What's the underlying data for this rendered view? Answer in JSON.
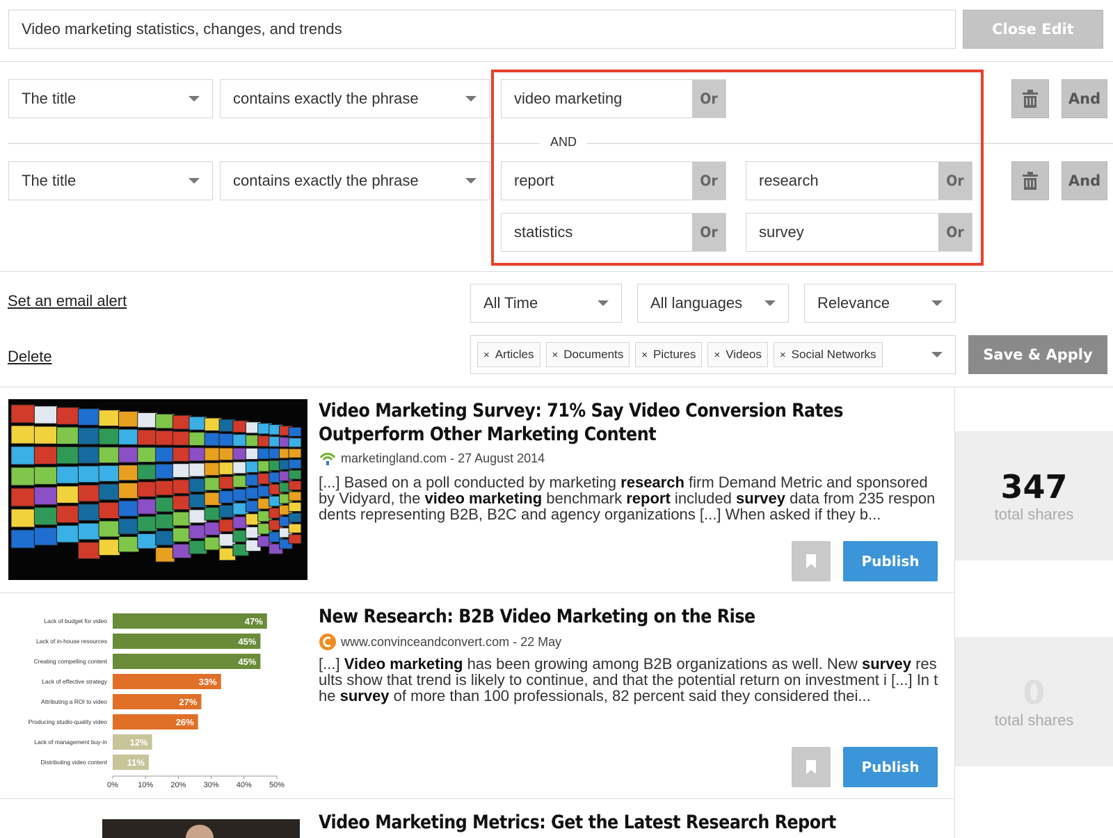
{
  "search": {
    "title_value": "Video marketing statistics, changes, and trends",
    "close_label": "Close Edit"
  },
  "rules": [
    {
      "field": "The title",
      "operator": "contains exactly the phrase",
      "terms": [
        {
          "text": "video marketing",
          "or": "Or"
        }
      ]
    },
    {
      "field": "The title",
      "operator": "contains exactly the phrase",
      "terms": [
        {
          "text": "report",
          "or": "Or"
        },
        {
          "text": "research",
          "or": "Or"
        },
        {
          "text": "statistics",
          "or": "Or"
        },
        {
          "text": "survey",
          "or": "Or"
        }
      ]
    }
  ],
  "and_separator": "AND",
  "and_button": "And",
  "highlight_color": "#e8402a",
  "links": {
    "email_alert": "Set an email alert",
    "delete": "Delete"
  },
  "filters": {
    "time": "All Time",
    "language": "All languages",
    "sort": "Relevance"
  },
  "types": [
    "Articles",
    "Documents",
    "Pictures",
    "Videos",
    "Social Networks"
  ],
  "save_apply": "Save & Apply",
  "results": [
    {
      "title": "Video Marketing Survey: 71% Say Video Conversion Rates Outperform Other Marketing Content",
      "source": "marketingland.com - 27 August 2014",
      "snippet_html": "[...] Based on a poll conducted by marketing <b>research</b> firm Demand Metric and sponsored by Vidyard, the <b>video marketing</b> benchmark <b>report</b> included <b>survey</b> data from 235 respondents representing B2B, B2C and agency organizations [...] When asked if they b...",
      "shares": "347",
      "shares_label": "total shares",
      "publish": "Publish"
    },
    {
      "title": "New Research: B2B Video Marketing on the Rise",
      "source": "www.convinceandconvert.com - 22 May",
      "snippet_html": "[...] <b>Video marketing</b> has been growing among B2B organizations as well. New <b>survey</b> results show that trend is likely to continue, and that the potential return on investment i [...] In the <b>survey</b> of more than 100 professionals, 82 percent said they considered thei...",
      "shares": "0",
      "shares_label": "total shares",
      "publish": "Publish"
    },
    {
      "title": "Video Marketing Metrics: Get the Latest Research Report"
    }
  ],
  "chart_data": {
    "type": "bar",
    "orientation": "horizontal",
    "categories": [
      "Lack of budget for video",
      "Lack of in-house resources",
      "Creating compelling content",
      "Lack of effective strategy",
      "Attributing a ROI to video",
      "Producing studio-quality video",
      "Lack of management buy-in",
      "Distributing video content"
    ],
    "values": [
      47,
      45,
      45,
      33,
      27,
      26,
      12,
      11
    ],
    "value_labels": [
      "47%",
      "45%",
      "45%",
      "33%",
      "27%",
      "26%",
      "12%",
      "11%"
    ],
    "colors": [
      "#6a8c3a",
      "#6a8c3a",
      "#6a8c3a",
      "#e07028",
      "#e07028",
      "#e07028",
      "#c8c49a",
      "#c8c49a"
    ],
    "xticks": [
      "0%",
      "10%",
      "20%",
      "30%",
      "40%",
      "50%"
    ],
    "xlim": [
      0,
      50
    ]
  }
}
